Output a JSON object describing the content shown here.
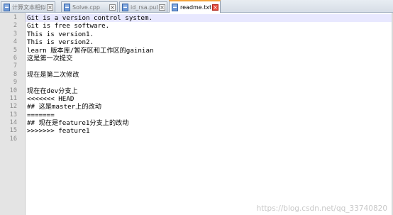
{
  "tabs": [
    {
      "label": "计算文本相似度.py",
      "active": false,
      "icon": "file-icon"
    },
    {
      "label": "Solve.cpp",
      "active": false,
      "icon": "file-icon"
    },
    {
      "label": "id_rsa.pub",
      "active": false,
      "icon": "file-icon"
    },
    {
      "label": "readme.txt",
      "active": true,
      "icon": "file-icon"
    }
  ],
  "editor": {
    "line_numbers": [
      "1",
      "2",
      "3",
      "4",
      "5",
      "6",
      "7",
      "8",
      "9",
      "10",
      "11",
      "12",
      "13",
      "14",
      "15",
      "16"
    ],
    "lines": [
      "Git is a version control system.",
      "Git is free software.",
      "This is version1.",
      "This is version2.",
      "learn 版本库/暂存区和工作区的gainian",
      "这是第一次提交",
      "",
      "现在是第二次修改",
      "",
      "现在在dev分支上",
      "<<<<<<< HEAD",
      "## 这是master上的改动",
      "=======",
      "## 现在是feature1分支上的改动",
      ">>>>>>> feature1",
      ""
    ],
    "current_line": "1"
  },
  "watermark": "https://blog.csdn.net/qq_33740820",
  "colors": {
    "active_tab_accent": "#f4a23a",
    "close_active": "#e54c3c",
    "current_line_bg": "#e8e8ff",
    "gutter_bg": "#e4e4e4"
  }
}
